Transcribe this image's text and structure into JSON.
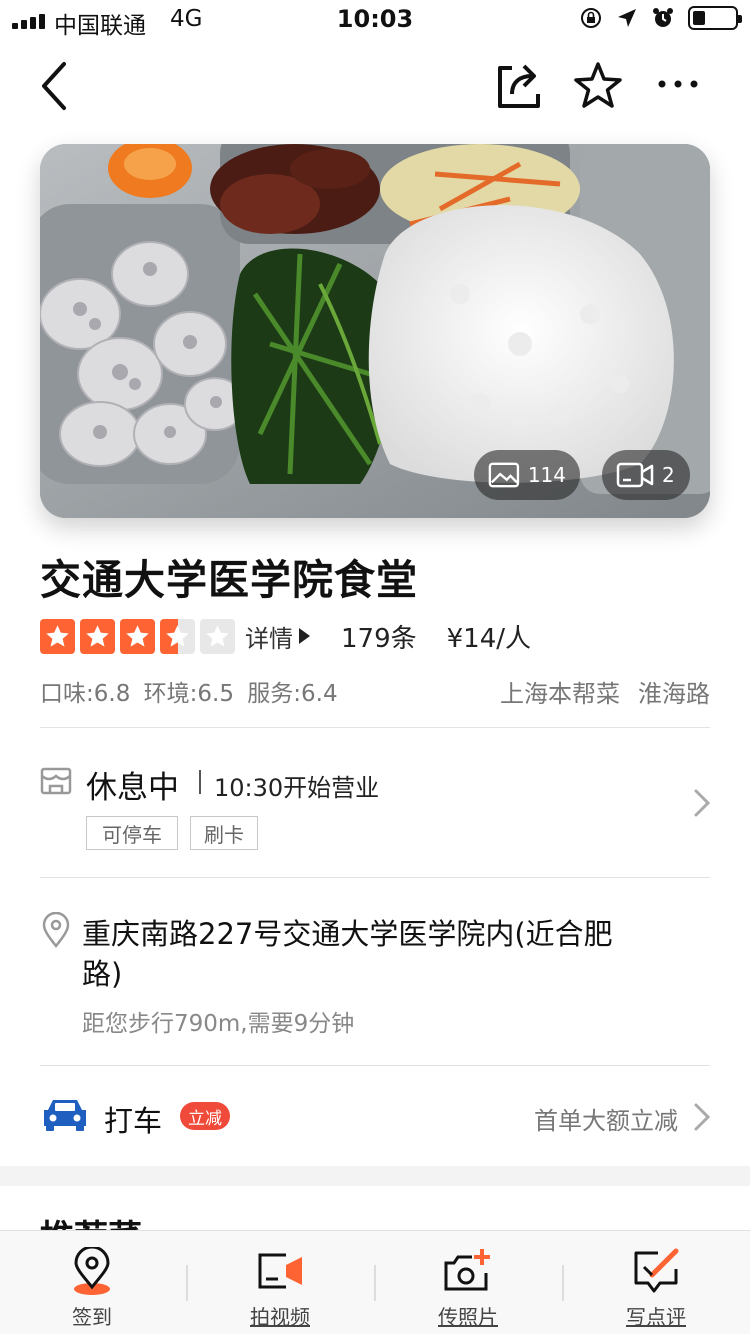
{
  "status_bar": {
    "carrier": "中国联通",
    "network": "4G",
    "time": "10:03",
    "battery_level": 0.3
  },
  "nav": {
    "back_icon": "chevron-left-icon",
    "share_icon": "share-icon",
    "favorite_icon": "star-outline-icon",
    "more_icon": "more-dots-icon"
  },
  "hero": {
    "photo_count": "114",
    "video_count": "2"
  },
  "restaurant": {
    "name": "交通大学医学院食堂",
    "rating_stars": 3.5,
    "detail_label": "详情",
    "review_count": "179条",
    "avg_price": "¥14/人",
    "scores": {
      "taste": "口味:6.8",
      "environment": "环境:6.5",
      "service": "服务:6.4"
    },
    "cuisine": "上海本帮菜",
    "district": "淮海路"
  },
  "hours": {
    "status": "休息中",
    "open_time": "10:30开始营业",
    "facilities": [
      "可停车",
      "刷卡"
    ]
  },
  "address": {
    "line": "重庆南路227号交通大学医学院内(近合肥路)",
    "distance": "距您步行790m,需要9分钟"
  },
  "taxi": {
    "label": "打车",
    "badge": "立减",
    "promo": "首单大额立减"
  },
  "recommend": {
    "title": "推荐菜"
  },
  "bottom_bar": {
    "items": [
      {
        "label": "签到",
        "icon": "location-pin-icon"
      },
      {
        "label": "拍视频",
        "icon": "video-record-icon"
      },
      {
        "label": "传照片",
        "icon": "camera-add-icon"
      },
      {
        "label": "写点评",
        "icon": "edit-review-icon"
      }
    ]
  },
  "colors": {
    "accent": "#fd6333",
    "badge_red": "#f04a3a",
    "taxi_blue": "#1f5fbf"
  }
}
